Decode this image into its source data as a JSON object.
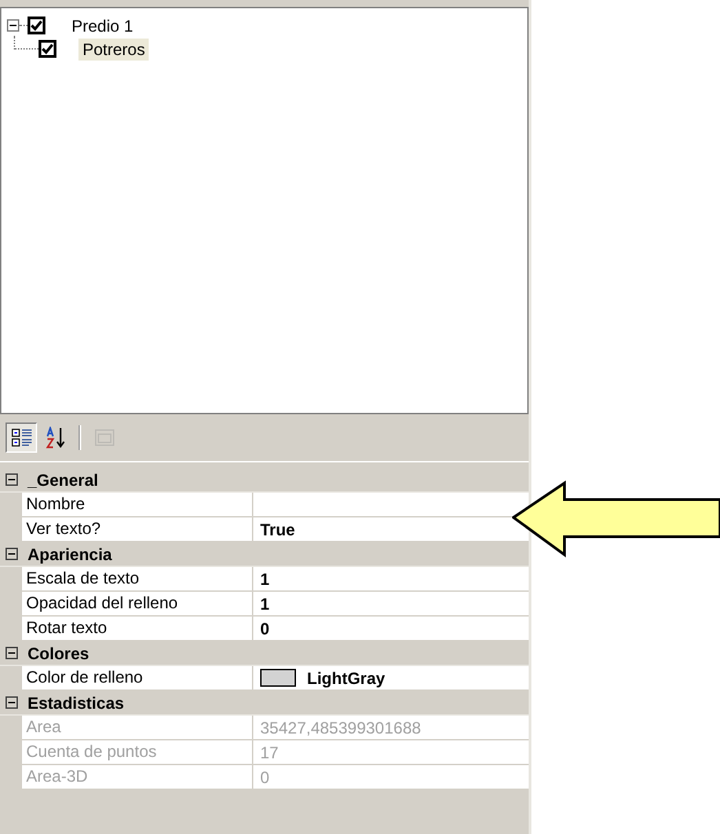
{
  "tree": [
    {
      "label": "Predio 1",
      "checked": true,
      "expanded": true,
      "selected": false,
      "children": [
        {
          "label": "Potreros",
          "checked": true,
          "selected": true
        }
      ]
    }
  ],
  "toolbar": [
    {
      "kind": "categorized",
      "selected": true,
      "disabled": false
    },
    {
      "kind": "alphabetical",
      "selected": false,
      "disabled": false
    },
    {
      "kind": "pages",
      "selected": false,
      "disabled": true
    }
  ],
  "categories": [
    {
      "name": "_General",
      "expanded": true,
      "properties": [
        {
          "name": "Nombre",
          "disabled": false
        },
        {
          "name": "Ver texto?",
          "value": "True",
          "disabled": false
        }
      ]
    },
    {
      "name": "Apariencia",
      "expanded": true,
      "properties": [
        {
          "name": "Escala de texto",
          "value": "1",
          "disabled": false
        },
        {
          "name": "Opacidad del relleno",
          "value": "1",
          "disabled": false
        },
        {
          "name": "Rotar texto",
          "value": "0",
          "disabled": false
        }
      ]
    },
    {
      "name": "Colores",
      "expanded": true,
      "properties": [
        {
          "name": "Color de relleno",
          "value": "LightGray",
          "color": "#d3d3d3",
          "disabled": false
        }
      ]
    },
    {
      "name": "Estadisticas",
      "expanded": true,
      "properties": [
        {
          "name": "Area",
          "value": "35427,485399301688",
          "disabled": true
        },
        {
          "name": "Cuenta de puntos",
          "value": "17",
          "disabled": true
        },
        {
          "name": "Area-3D",
          "value": "0",
          "disabled": true
        }
      ]
    }
  ]
}
